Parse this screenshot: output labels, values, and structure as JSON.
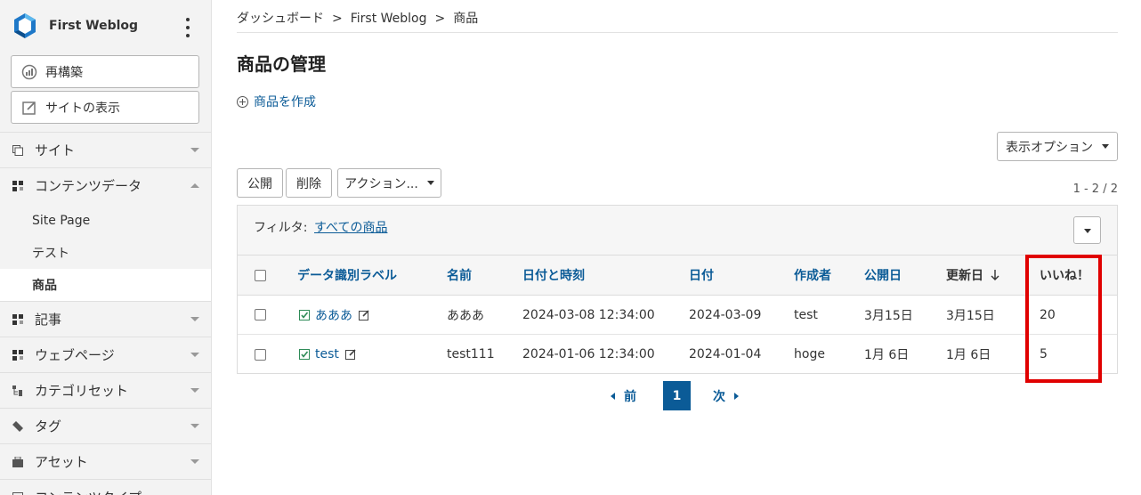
{
  "sidebar": {
    "blog_name": "First Weblog",
    "rebuild_label": "再構築",
    "view_site_label": "サイトの表示",
    "items": [
      {
        "label": "サイト",
        "icon": "site-icon"
      },
      {
        "label": "コンテンツデータ",
        "icon": "content-data-icon"
      },
      {
        "label": "記事",
        "icon": "entry-icon"
      },
      {
        "label": "ウェブページ",
        "icon": "webpage-icon"
      },
      {
        "label": "カテゴリセット",
        "icon": "category-set-icon"
      },
      {
        "label": "タグ",
        "icon": "tag-icon"
      },
      {
        "label": "アセット",
        "icon": "asset-icon"
      },
      {
        "label": "コンテンツタイプ",
        "icon": "content-type-icon"
      }
    ],
    "sub_items": [
      "Site Page",
      "テスト",
      "商品"
    ]
  },
  "breadcrumb": [
    "ダッシュボード",
    "First Weblog",
    "商品"
  ],
  "breadcrumb_sep": ">",
  "page_title": "商品の管理",
  "create_label": "商品を作成",
  "display_options_label": "表示オプション",
  "actions": {
    "publish": "公開",
    "delete": "削除",
    "more": "アクション..."
  },
  "count_text": "1 - 2 / 2",
  "filter": {
    "label": "フィルタ:",
    "value": "すべての商品"
  },
  "columns": [
    "データ識別ラベル",
    "名前",
    "日付と時刻",
    "日付",
    "作成者",
    "公開日",
    "更新日",
    "いいね！"
  ],
  "rows": [
    {
      "label": "あああ",
      "name": "あああ",
      "datetime": "2024-03-08 12:34:00",
      "date": "2024-03-09",
      "author": "test",
      "published": "3月15日",
      "updated": "3月15日",
      "likes": "20"
    },
    {
      "label": "test",
      "name": "test111",
      "datetime": "2024-01-06 12:34:00",
      "date": "2024-01-04",
      "author": "hoge",
      "published": "1月 6日",
      "updated": "1月 6日",
      "likes": "5"
    }
  ],
  "pager": {
    "prev": "前",
    "current": "1",
    "next": "次"
  },
  "colors": {
    "link": "#0b5b97",
    "highlight": "#e00000",
    "status_published": "#2e8b57"
  }
}
